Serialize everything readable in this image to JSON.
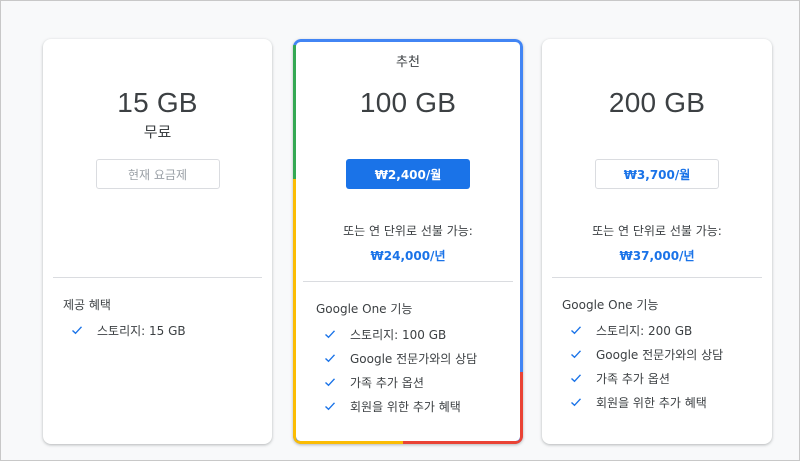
{
  "plans": [
    {
      "size": "15 GB",
      "subprice": "무료",
      "button_label": "현재 요금제",
      "benefits_title": "제공 혜택",
      "features": [
        "스토리지: 15 GB"
      ]
    },
    {
      "badge": "추천",
      "size": "100 GB",
      "button_label": "₩2,400/월",
      "yearly_text": "또는 연 단위로 선불 가능:",
      "yearly_price": "₩24,000/년",
      "benefits_title": "Google One 기능",
      "features": [
        "스토리지: 100 GB",
        "Google 전문가와의 상담",
        "가족 추가 옵션",
        "회원을 위한 추가 혜택"
      ]
    },
    {
      "size": "200 GB",
      "button_label": "₩3,700/월",
      "yearly_text": "또는 연 단위로 선불 가능:",
      "yearly_price": "₩37,000/년",
      "benefits_title": "Google One 기능",
      "features": [
        "스토리지: 200 GB",
        "Google 전문가와의 상담",
        "가족 추가 옵션",
        "회원을 위한 추가 혜택"
      ]
    }
  ],
  "colors": {
    "primary_blue": "#1a73e8",
    "google_blue": "#4285f4",
    "google_green": "#34a853",
    "google_yellow": "#fbbc04",
    "google_red": "#ea4335"
  },
  "icons": {
    "feature_check": "check-icon"
  }
}
